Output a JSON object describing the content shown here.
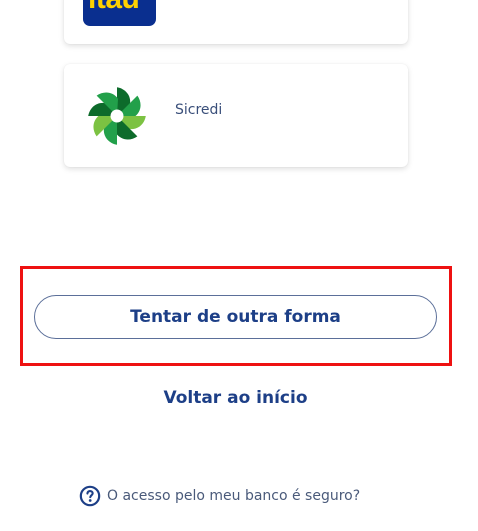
{
  "banks": [
    {
      "name": "Itaú",
      "logo_text": "itaú",
      "logo_bg": "#0a2f8f",
      "logo_fg": "#ffd200"
    },
    {
      "name": "Sicredi",
      "logo_icon": "sicredi-logo-icon",
      "logo_colors": [
        "#0d6b2b",
        "#22a04a",
        "#7cc242"
      ]
    }
  ],
  "actions": {
    "try_another": "Tentar de outra forma",
    "back_home": "Voltar ao início"
  },
  "help": {
    "icon": "question-circle-icon",
    "text": "O acesso pelo meu banco é seguro?"
  },
  "colors": {
    "primary": "#1d3f87",
    "highlight": "#ee1111"
  }
}
